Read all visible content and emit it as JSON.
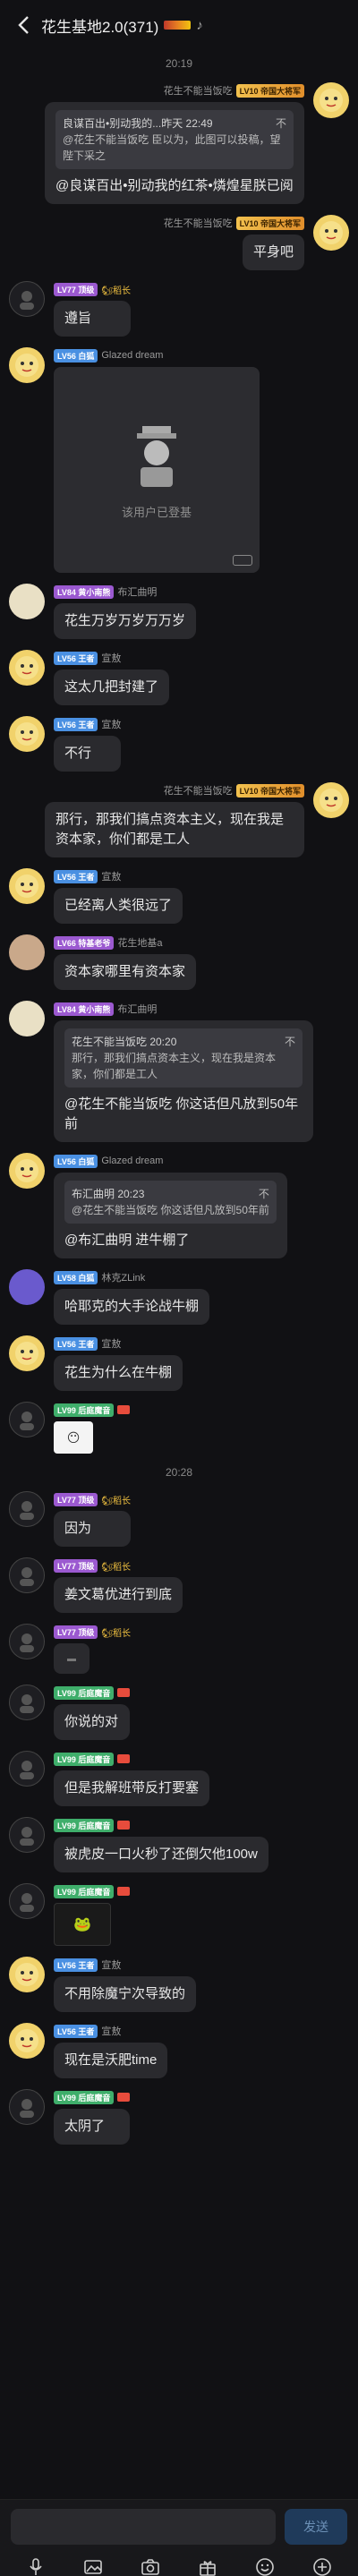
{
  "header": {
    "title": "花生基地2.0(371)"
  },
  "chat": {
    "times": [
      "20:19",
      "20:28"
    ],
    "messages": [
      {
        "side": "right",
        "avatar": "yellow",
        "lvl": "LV10 帝国大将军",
        "lvlc": "lv-gold",
        "name": "花生不能当饭吃",
        "type": "quote",
        "quote_head": "良谋百出•别动我的...昨天 22:49",
        "quote_text": "@花生不能当饭吃 臣以为，此图可以投稿，望陛下采之",
        "text": "@良谋百出•别动我的红茶•燐煌星朕已阅"
      },
      {
        "side": "right",
        "avatar": "yellow",
        "lvl": "LV10 帝国大将军",
        "lvlc": "lv-gold",
        "name": "花生不能当饭吃",
        "type": "text",
        "text": "平身吧"
      },
      {
        "side": "left",
        "avatar": "dark",
        "lvl": "LV77 顶级",
        "lvlc": "lv-purple",
        "name": "",
        "title": "🐿稻长",
        "type": "text",
        "text": "遵旨"
      },
      {
        "side": "left",
        "avatar": "yellow",
        "lvl": "LV56 白狐",
        "lvlc": "lv-blue",
        "name": "Glazed dream",
        "type": "image",
        "caption": "该用户已登基"
      },
      {
        "side": "left",
        "avatar": "cream",
        "lvl": "LV84 黄小南熊",
        "lvlc": "lv-purple",
        "name": "布汇曲明",
        "type": "text",
        "text": "花生万岁万岁万万岁"
      },
      {
        "side": "left",
        "avatar": "yellow",
        "lvl": "LV56 王者",
        "lvlc": "lv-blue",
        "name": "宣敖",
        "type": "text",
        "text": "这太几把封建了"
      },
      {
        "side": "left",
        "avatar": "yellow",
        "lvl": "LV56 王者",
        "lvlc": "lv-blue",
        "name": "宣敖",
        "type": "text",
        "text": "不行"
      },
      {
        "side": "right",
        "avatar": "yellow",
        "lvl": "LV10 帝国大将军",
        "lvlc": "lv-gold",
        "name": "花生不能当饭吃",
        "type": "text",
        "text": "那行，那我们搞点资本主义，现在我是资本家，你们都是工人"
      },
      {
        "side": "left",
        "avatar": "yellow",
        "lvl": "LV56 王者",
        "lvlc": "lv-blue",
        "name": "宣敖",
        "type": "text",
        "text": "已经离人类很远了"
      },
      {
        "side": "left",
        "avatar": "girl",
        "lvl": "LV66 特基老爷",
        "lvlc": "lv-purple",
        "name": "花生地基a",
        "type": "text",
        "text": "资本家哪里有资本家"
      },
      {
        "side": "left",
        "avatar": "cream",
        "lvl": "LV84 黄小南熊",
        "lvlc": "lv-purple",
        "name": "布汇曲明",
        "type": "quote",
        "quote_head": "花生不能当饭吃 20:20",
        "quote_text": "那行，那我们搞点资本主义，现在我是资本家，你们都是工人",
        "text": "@花生不能当饭吃 你这话但凡放到50年前"
      },
      {
        "side": "left",
        "avatar": "yellow",
        "lvl": "LV56 白狐",
        "lvlc": "lv-blue",
        "name": "Glazed dream",
        "type": "quote",
        "quote_head": "布汇曲明 20:23",
        "quote_text": "@花生不能当饭吃 你这话但凡放到50年前",
        "text": "@布汇曲明 进牛棚了"
      },
      {
        "side": "left",
        "avatar": "anime",
        "lvl": "LV58 白狐",
        "lvlc": "lv-blue",
        "name": "林克ZLink",
        "type": "text",
        "text": "哈耶克的大手论战牛棚"
      },
      {
        "side": "left",
        "avatar": "yellow",
        "lvl": "LV56 王者",
        "lvlc": "lv-blue",
        "name": "宣敖",
        "type": "text",
        "text": "花生为什么在牛棚"
      },
      {
        "side": "left",
        "avatar": "dark",
        "lvl": "LV99 后庭魔音",
        "lvlc": "lv-green",
        "name": "",
        "type": "sticker",
        "text": "😶"
      },
      {
        "side": "left",
        "avatar": "dark",
        "lvl": "LV77 顶级",
        "lvlc": "lv-purple",
        "name": "",
        "title": "🐿稻长",
        "type": "text",
        "text": "因为"
      },
      {
        "side": "left",
        "avatar": "dark",
        "lvl": "LV77 顶级",
        "lvlc": "lv-purple",
        "name": "",
        "title": "🐿稻长",
        "type": "text",
        "text": "姜文葛优进行到底"
      },
      {
        "side": "left",
        "avatar": "dark",
        "lvl": "LV77 顶级",
        "lvlc": "lv-purple",
        "name": "",
        "title": "🐿稻长",
        "type": "small",
        "text": "▬"
      },
      {
        "side": "left",
        "avatar": "dark",
        "lvl": "LV99 后庭魔音",
        "lvlc": "lv-green",
        "name": "",
        "type": "text",
        "text": "你说的对"
      },
      {
        "side": "left",
        "avatar": "dark",
        "lvl": "LV99 后庭魔音",
        "lvlc": "lv-green",
        "name": "",
        "type": "text",
        "text": "但是我解班带反打要塞"
      },
      {
        "side": "left",
        "avatar": "dark",
        "lvl": "LV99 后庭魔音",
        "lvlc": "lv-green",
        "name": "",
        "type": "text",
        "text": "被虎皮一口火秒了还倒欠他100w"
      },
      {
        "side": "left",
        "avatar": "dark",
        "lvl": "LV99 后庭魔音",
        "lvlc": "lv-green",
        "name": "",
        "type": "sticker2",
        "text": "🐸"
      },
      {
        "side": "left",
        "avatar": "yellow",
        "lvl": "LV56 王者",
        "lvlc": "lv-blue",
        "name": "宣敖",
        "type": "text",
        "text": "不用除魔宁次导致的"
      },
      {
        "side": "left",
        "avatar": "yellow",
        "lvl": "LV56 王者",
        "lvlc": "lv-blue",
        "name": "宣敖",
        "type": "text",
        "text": "现在是沃肥time"
      },
      {
        "side": "left",
        "avatar": "dark",
        "lvl": "LV99 后庭魔音",
        "lvlc": "lv-green",
        "name": "",
        "type": "text",
        "text": "太阴了"
      }
    ]
  },
  "composer": {
    "send_label": "发送"
  },
  "tools": [
    "mic-icon",
    "image-icon",
    "camera-icon",
    "gift-icon",
    "emoji-icon",
    "plus-icon"
  ]
}
